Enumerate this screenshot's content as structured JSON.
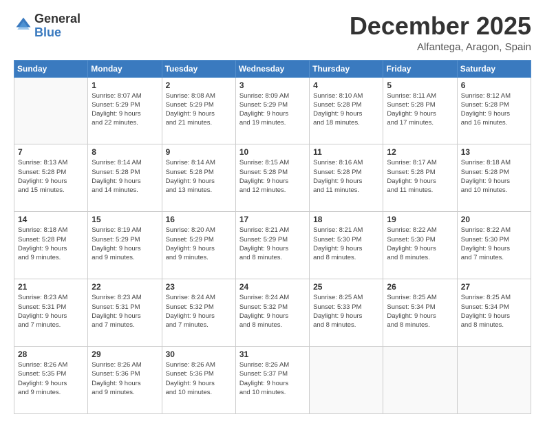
{
  "header": {
    "logo_general": "General",
    "logo_blue": "Blue",
    "month_title": "December 2025",
    "location": "Alfantega, Aragon, Spain"
  },
  "weekdays": [
    "Sunday",
    "Monday",
    "Tuesday",
    "Wednesday",
    "Thursday",
    "Friday",
    "Saturday"
  ],
  "weeks": [
    [
      {
        "day": "",
        "info": ""
      },
      {
        "day": "1",
        "info": "Sunrise: 8:07 AM\nSunset: 5:29 PM\nDaylight: 9 hours\nand 22 minutes."
      },
      {
        "day": "2",
        "info": "Sunrise: 8:08 AM\nSunset: 5:29 PM\nDaylight: 9 hours\nand 21 minutes."
      },
      {
        "day": "3",
        "info": "Sunrise: 8:09 AM\nSunset: 5:29 PM\nDaylight: 9 hours\nand 19 minutes."
      },
      {
        "day": "4",
        "info": "Sunrise: 8:10 AM\nSunset: 5:28 PM\nDaylight: 9 hours\nand 18 minutes."
      },
      {
        "day": "5",
        "info": "Sunrise: 8:11 AM\nSunset: 5:28 PM\nDaylight: 9 hours\nand 17 minutes."
      },
      {
        "day": "6",
        "info": "Sunrise: 8:12 AM\nSunset: 5:28 PM\nDaylight: 9 hours\nand 16 minutes."
      }
    ],
    [
      {
        "day": "7",
        "info": "Sunrise: 8:13 AM\nSunset: 5:28 PM\nDaylight: 9 hours\nand 15 minutes."
      },
      {
        "day": "8",
        "info": "Sunrise: 8:14 AM\nSunset: 5:28 PM\nDaylight: 9 hours\nand 14 minutes."
      },
      {
        "day": "9",
        "info": "Sunrise: 8:14 AM\nSunset: 5:28 PM\nDaylight: 9 hours\nand 13 minutes."
      },
      {
        "day": "10",
        "info": "Sunrise: 8:15 AM\nSunset: 5:28 PM\nDaylight: 9 hours\nand 12 minutes."
      },
      {
        "day": "11",
        "info": "Sunrise: 8:16 AM\nSunset: 5:28 PM\nDaylight: 9 hours\nand 11 minutes."
      },
      {
        "day": "12",
        "info": "Sunrise: 8:17 AM\nSunset: 5:28 PM\nDaylight: 9 hours\nand 11 minutes."
      },
      {
        "day": "13",
        "info": "Sunrise: 8:18 AM\nSunset: 5:28 PM\nDaylight: 9 hours\nand 10 minutes."
      }
    ],
    [
      {
        "day": "14",
        "info": "Sunrise: 8:18 AM\nSunset: 5:28 PM\nDaylight: 9 hours\nand 9 minutes."
      },
      {
        "day": "15",
        "info": "Sunrise: 8:19 AM\nSunset: 5:29 PM\nDaylight: 9 hours\nand 9 minutes."
      },
      {
        "day": "16",
        "info": "Sunrise: 8:20 AM\nSunset: 5:29 PM\nDaylight: 9 hours\nand 9 minutes."
      },
      {
        "day": "17",
        "info": "Sunrise: 8:21 AM\nSunset: 5:29 PM\nDaylight: 9 hours\nand 8 minutes."
      },
      {
        "day": "18",
        "info": "Sunrise: 8:21 AM\nSunset: 5:30 PM\nDaylight: 9 hours\nand 8 minutes."
      },
      {
        "day": "19",
        "info": "Sunrise: 8:22 AM\nSunset: 5:30 PM\nDaylight: 9 hours\nand 8 minutes."
      },
      {
        "day": "20",
        "info": "Sunrise: 8:22 AM\nSunset: 5:30 PM\nDaylight: 9 hours\nand 7 minutes."
      }
    ],
    [
      {
        "day": "21",
        "info": "Sunrise: 8:23 AM\nSunset: 5:31 PM\nDaylight: 9 hours\nand 7 minutes."
      },
      {
        "day": "22",
        "info": "Sunrise: 8:23 AM\nSunset: 5:31 PM\nDaylight: 9 hours\nand 7 minutes."
      },
      {
        "day": "23",
        "info": "Sunrise: 8:24 AM\nSunset: 5:32 PM\nDaylight: 9 hours\nand 7 minutes."
      },
      {
        "day": "24",
        "info": "Sunrise: 8:24 AM\nSunset: 5:32 PM\nDaylight: 9 hours\nand 8 minutes."
      },
      {
        "day": "25",
        "info": "Sunrise: 8:25 AM\nSunset: 5:33 PM\nDaylight: 9 hours\nand 8 minutes."
      },
      {
        "day": "26",
        "info": "Sunrise: 8:25 AM\nSunset: 5:34 PM\nDaylight: 9 hours\nand 8 minutes."
      },
      {
        "day": "27",
        "info": "Sunrise: 8:25 AM\nSunset: 5:34 PM\nDaylight: 9 hours\nand 8 minutes."
      }
    ],
    [
      {
        "day": "28",
        "info": "Sunrise: 8:26 AM\nSunset: 5:35 PM\nDaylight: 9 hours\nand 9 minutes."
      },
      {
        "day": "29",
        "info": "Sunrise: 8:26 AM\nSunset: 5:36 PM\nDaylight: 9 hours\nand 9 minutes."
      },
      {
        "day": "30",
        "info": "Sunrise: 8:26 AM\nSunset: 5:36 PM\nDaylight: 9 hours\nand 10 minutes."
      },
      {
        "day": "31",
        "info": "Sunrise: 8:26 AM\nSunset: 5:37 PM\nDaylight: 9 hours\nand 10 minutes."
      },
      {
        "day": "",
        "info": ""
      },
      {
        "day": "",
        "info": ""
      },
      {
        "day": "",
        "info": ""
      }
    ]
  ]
}
